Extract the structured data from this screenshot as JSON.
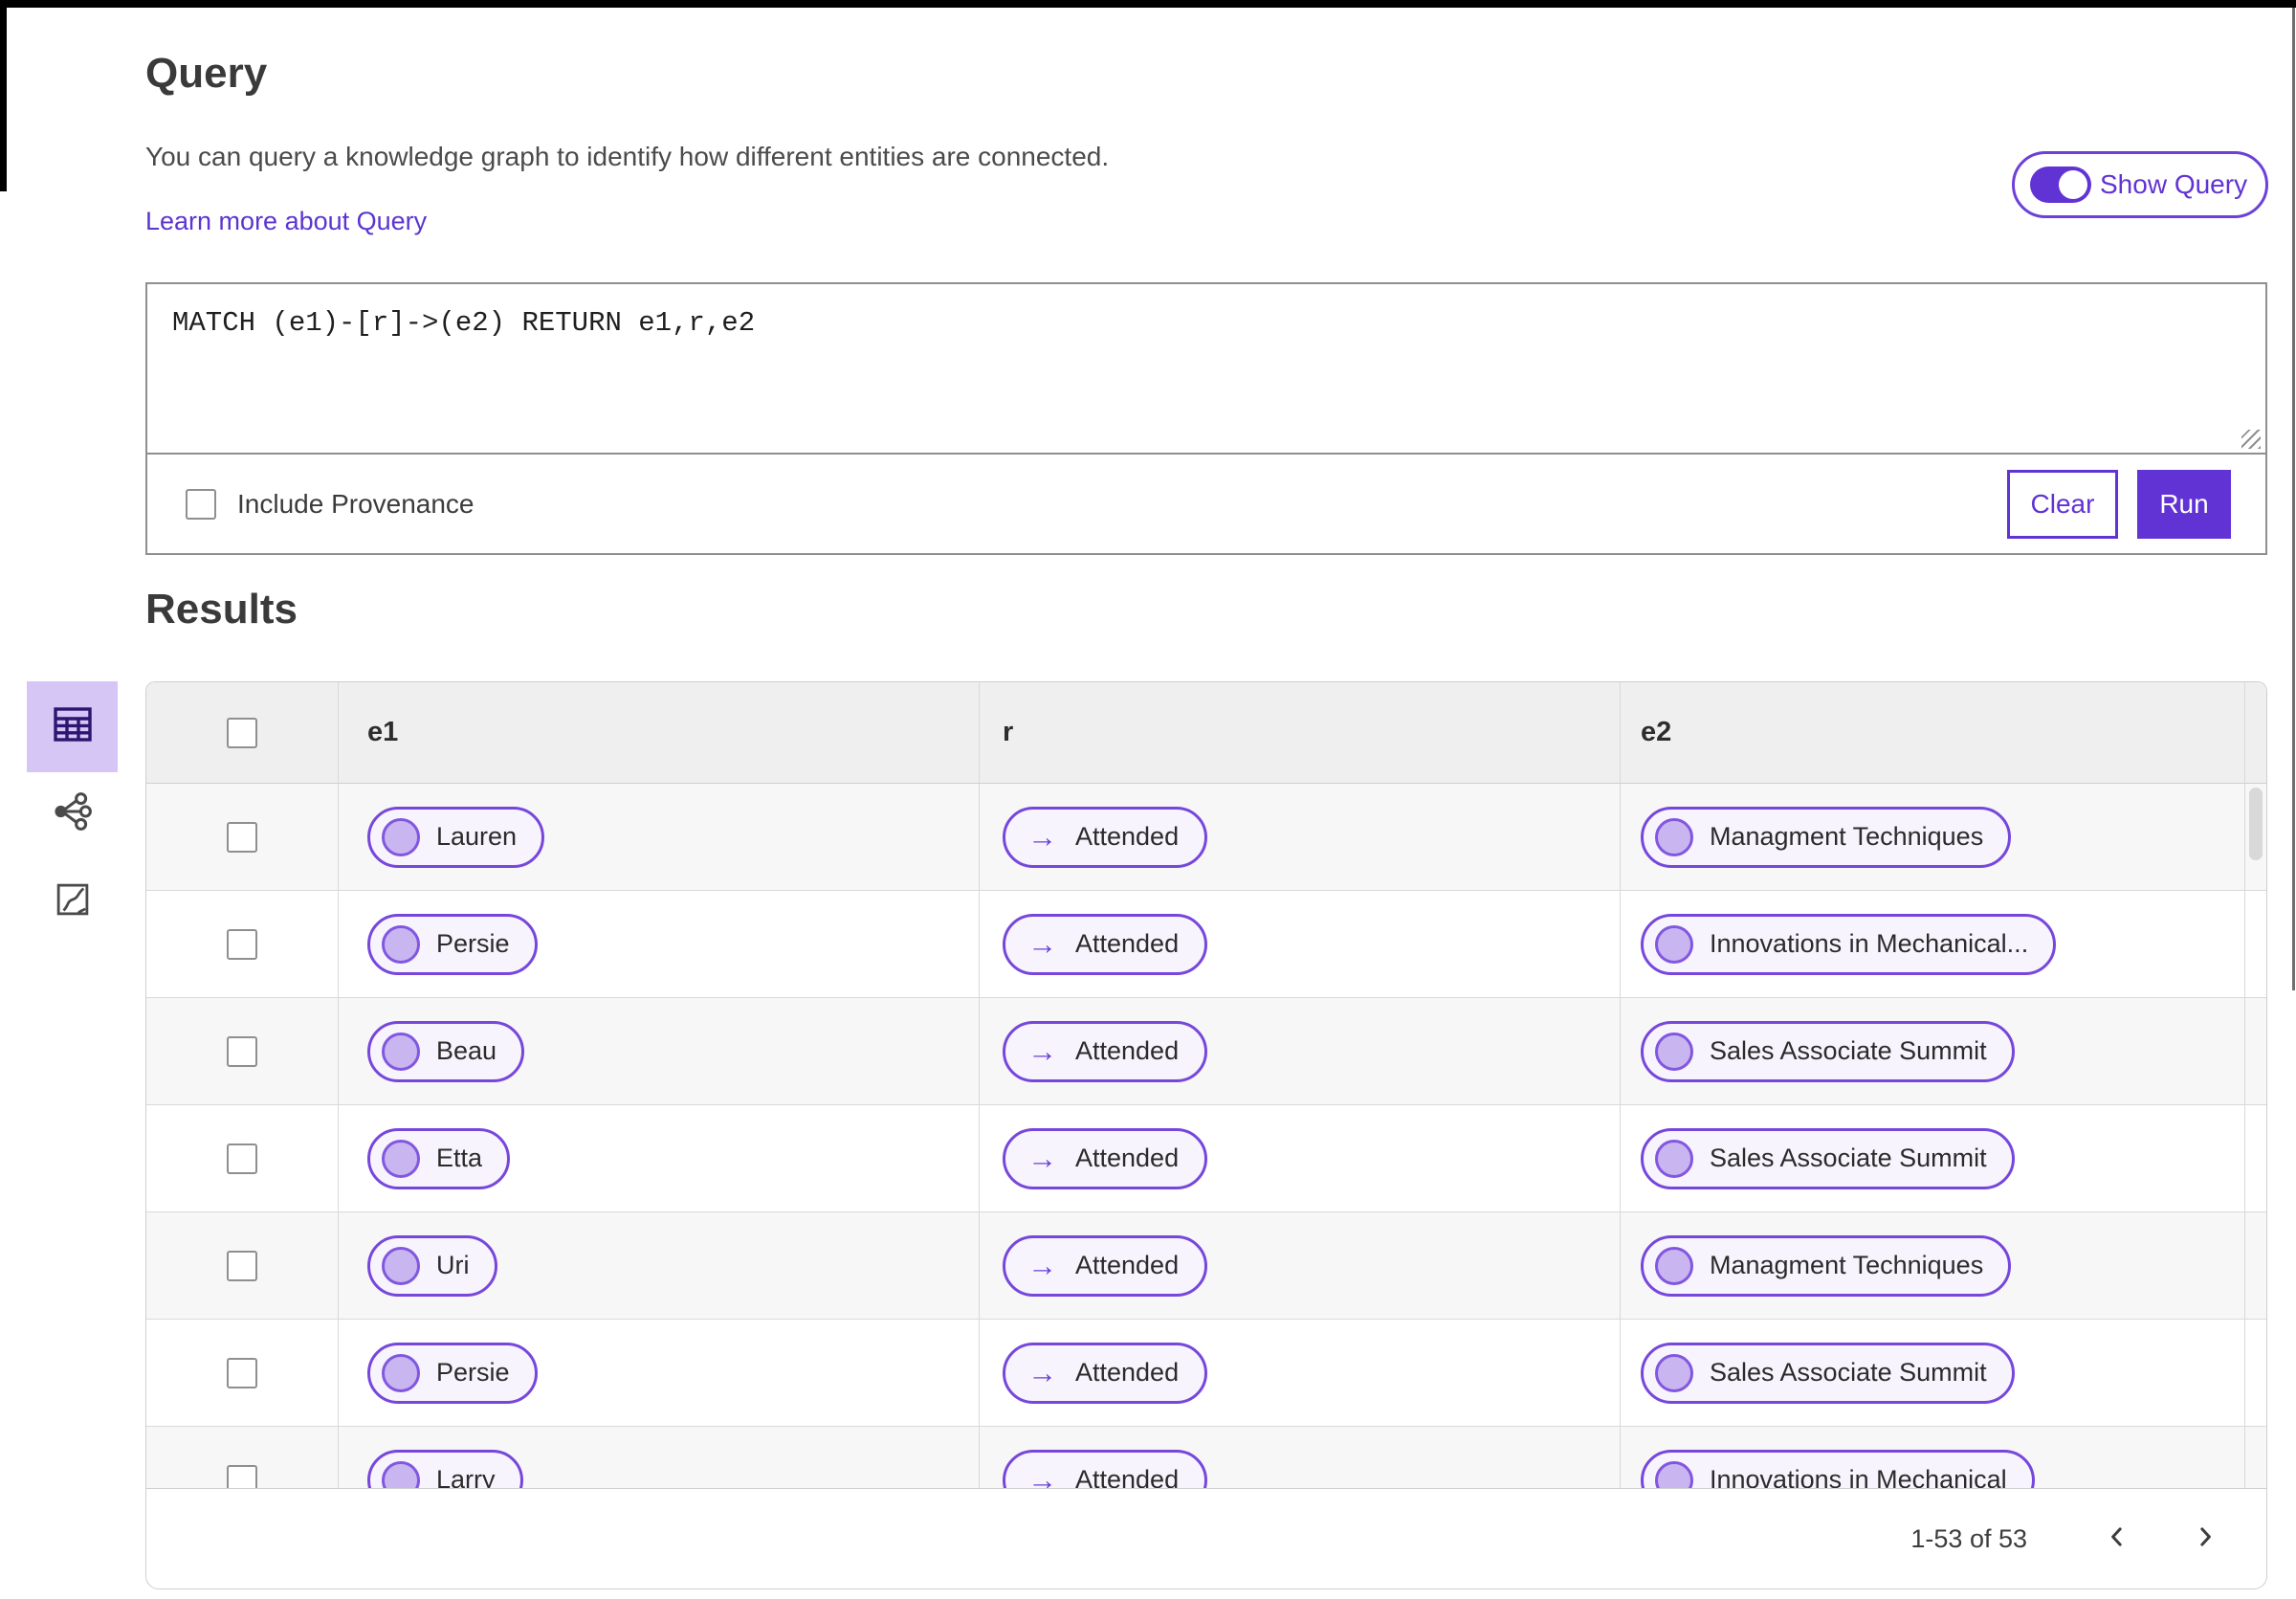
{
  "query_section": {
    "title": "Query",
    "description": "You can query a knowledge graph to identify how different entities are connected.",
    "learn_more_link": "Learn more about Query",
    "show_query_toggle": {
      "label": "Show Query",
      "state": "on"
    },
    "query_input": {
      "value": "MATCH (e1)-[r]->(e2) RETURN e1,r,e2"
    },
    "include_provenance": {
      "label": "Include Provenance",
      "checked": false
    },
    "buttons": {
      "clear": "Clear",
      "run": "Run"
    }
  },
  "results_section": {
    "title": "Results",
    "view_switcher": {
      "selected": "table-view",
      "options": [
        {
          "name": "table-view",
          "selected": true
        },
        {
          "name": "graph-view",
          "selected": false
        },
        {
          "name": "map-view",
          "selected": false
        }
      ]
    },
    "table": {
      "select_all_checked": false,
      "columns": [
        "e1",
        "r",
        "e2"
      ],
      "relation_arrow": "→",
      "rows": [
        {
          "checked": false,
          "e1": "Lauren",
          "r": "Attended",
          "e2": "Managment Techniques"
        },
        {
          "checked": false,
          "e1": "Persie",
          "r": "Attended",
          "e2": "Innovations in Mechanical..."
        },
        {
          "checked": false,
          "e1": "Beau",
          "r": "Attended",
          "e2": "Sales Associate Summit"
        },
        {
          "checked": false,
          "e1": "Etta",
          "r": "Attended",
          "e2": "Sales Associate Summit"
        },
        {
          "checked": false,
          "e1": "Uri",
          "r": "Attended",
          "e2": "Managment Techniques"
        },
        {
          "checked": false,
          "e1": "Persie",
          "r": "Attended",
          "e2": "Sales Associate Summit"
        },
        {
          "checked": false,
          "e1": "Larry",
          "r": "Attended",
          "e2": "Innovations in Mechanical"
        }
      ]
    },
    "pagination": {
      "range_label": "1-53 of 53",
      "prev_icon": "chevron-left",
      "next_icon": "chevron-right"
    }
  },
  "colors": {
    "primary_purple": "#6133D4",
    "pill_border": "#7747DC",
    "pill_background": "#F7F4FD",
    "pill_circle_fill": "#C9B6F0",
    "selected_tile_background": "#D5C6F6",
    "table_header_background": "#EFEFEF",
    "row_alt_background": "#F7F7F7",
    "link": "#5B35CF"
  }
}
